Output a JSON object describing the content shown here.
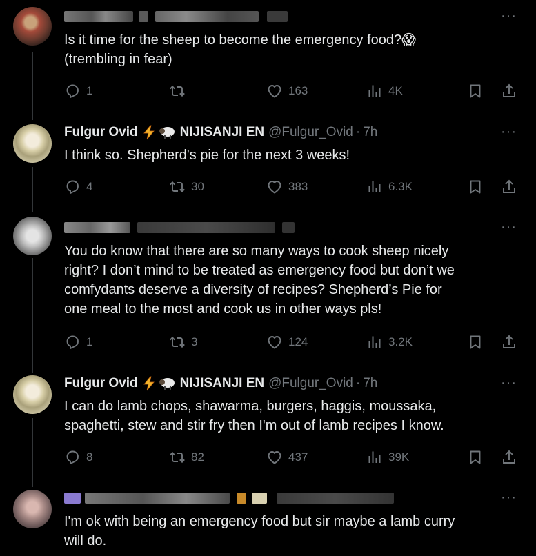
{
  "tweets": [
    {
      "id": "t1",
      "author_name": "",
      "text_lines": [
        "Is it time for the sheep to become the emergency food?😱",
        "(trembling in fear)"
      ],
      "stats": {
        "replies": "1",
        "retweets": "",
        "likes": "163",
        "views": "4K"
      }
    },
    {
      "id": "t2",
      "author_name": "Fulgur Ovid",
      "org": "NIJISANJI EN",
      "handle": "@Fulgur_Ovid",
      "time": "7h",
      "text_lines": [
        "I think so. Shepherd's pie for the next 3 weeks!"
      ],
      "stats": {
        "replies": "4",
        "retweets": "30",
        "likes": "383",
        "views": "6.3K"
      }
    },
    {
      "id": "t3",
      "author_name": "",
      "text_lines": [
        "You do know that there are so many ways to cook sheep nicely",
        "right? I don’t mind to be treated as emergency food but don’t we",
        "comfydants deserve a diversity of recipes? Shepherd’s Pie for",
        "one meal to the most and cook us in other ways pls!"
      ],
      "stats": {
        "replies": "1",
        "retweets": "3",
        "likes": "124",
        "views": "3.2K"
      }
    },
    {
      "id": "t4",
      "author_name": "Fulgur Ovid",
      "org": "NIJISANJI EN",
      "handle": "@Fulgur_Ovid",
      "time": "7h",
      "text_lines": [
        "I can do lamb chops, shawarma, burgers, haggis, moussaka,",
        "spaghetti, stew and stir fry then I'm out of lamb recipes I know."
      ],
      "stats": {
        "replies": "8",
        "retweets": "82",
        "likes": "437",
        "views": "39K"
      }
    },
    {
      "id": "t5",
      "author_name": "",
      "text_lines": [
        "I'm ok with being an emergency food but sir maybe a lamb curry",
        "will do."
      ]
    }
  ],
  "ui": {
    "more_glyph": "···",
    "dot": "·"
  },
  "colors": {
    "background": "#000000",
    "text": "#e7e9ea",
    "muted": "#71767b",
    "line": "#333639"
  }
}
